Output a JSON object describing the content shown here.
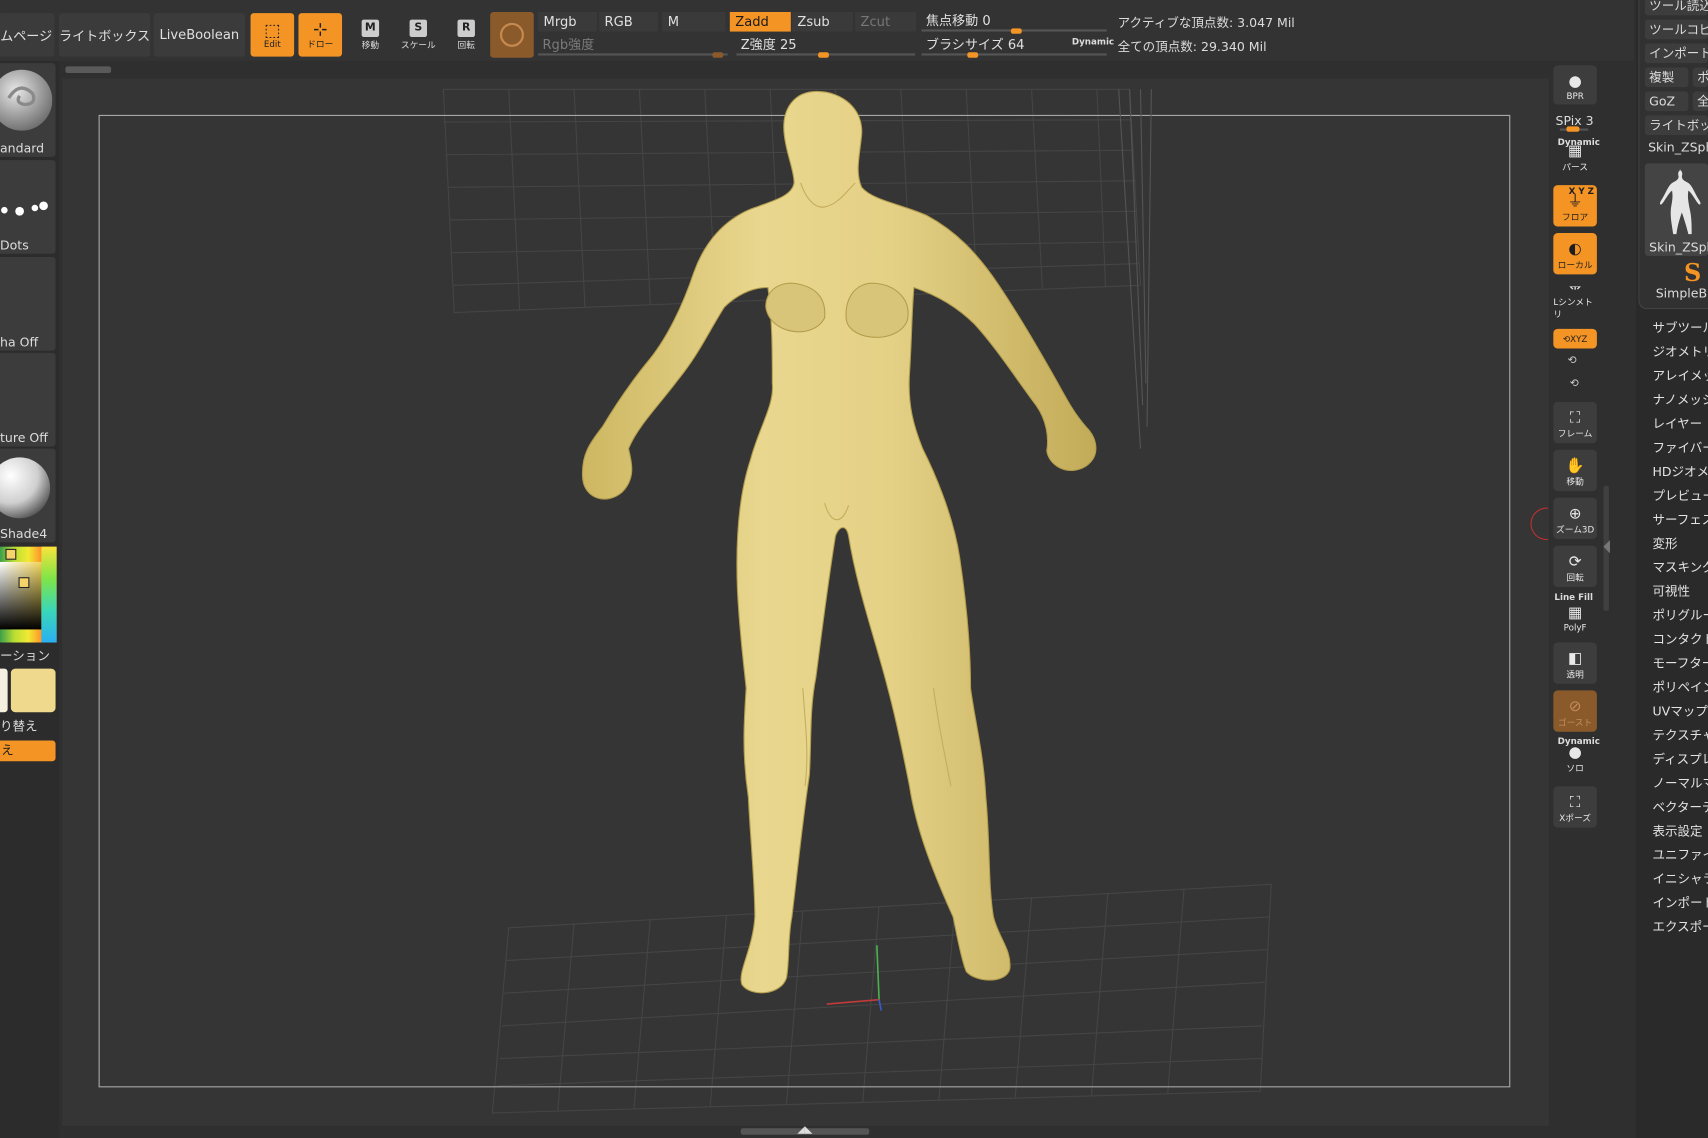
{
  "topbar": {
    "btn_page": "ムページ",
    "btn_lightbox": "ライトボックス",
    "btn_liveboolean": "LiveBoolean",
    "btn_edit": "Edit",
    "btn_draw": "ドロー",
    "btn_move": "移動",
    "btn_scale": "スケール",
    "btn_rotate": "回転",
    "seg_mrgb": "Mrgb",
    "seg_rgb": "RGB",
    "seg_m": "M",
    "seg_zadd": "Zadd",
    "seg_zsub": "Zsub",
    "seg_zcut": "Zcut",
    "rgb_intensity": "Rgb強度",
    "z_intensity": "Z強度 25",
    "focal_shift": "焦点移動 0",
    "brush_size": "ブラシサイズ 64",
    "dynamic": "Dynamic",
    "active_points": "アクティブな頂点数: 3.047 Mil",
    "total_points": "全ての頂点数: 29.340 Mil"
  },
  "leftshelf": {
    "brush": "andard",
    "stroke": "Dots",
    "alpha": "ha Off",
    "texture": "ture Off",
    "material": "Shade4",
    "gradient": "ーション",
    "switch_label": "り替え",
    "switch_button": "え"
  },
  "rightshelf": {
    "bpr": "BPR",
    "spix": "SPix 3",
    "dynamic": "Dynamic",
    "perspective": "パース",
    "floor": "フロア",
    "floor_axes": "X Y Z",
    "local": "ローカル",
    "lsym": "Lシンメトリ",
    "xyz": "⟲XYZ",
    "frame": "フレーム",
    "move": "移動",
    "zoom3d": "ズーム3D",
    "rotate": "回転",
    "linefill": "Line Fill",
    "polyf": "PolyF",
    "transp": "透明",
    "ghost": "ゴースト",
    "dynamic2": "Dynamic",
    "solo": "ソロ",
    "xpose": "Xポーズ"
  },
  "toolpanel": {
    "load_tool": "ツール読込",
    "copy_tool": "ツールコピ",
    "import": "インポート",
    "clone": "複製",
    "po": "ポ",
    "goz": "GoZ",
    "all": "全",
    "lightbox": "ライトボッ",
    "current_tool": "Skin_ZSph",
    "thumb_caption": "Skin_ZSph",
    "simple_brush": "SimpleBr",
    "menu": [
      "サブツール",
      "ジオメトリ",
      "アレイメッ",
      "ナノメッシ",
      "レイヤー",
      "ファイバー",
      "HDジオメ",
      "プレビュー",
      "サーフェス",
      "変形",
      "マスキング",
      "可視性",
      "ポリグルー",
      "コンタクト",
      "モーフター",
      "ポリペイン",
      "UVマップ",
      "テクスチャ",
      "ディスプレ",
      "ノーマルマ",
      "ベクターデ",
      "表示設定",
      "ユニファイ",
      "イニシャラ",
      "インポート",
      "エクスポー"
    ]
  },
  "colors": {
    "accent": "#f39425",
    "model": "#e6d284",
    "ghost_brown": "#8a5a2b"
  }
}
